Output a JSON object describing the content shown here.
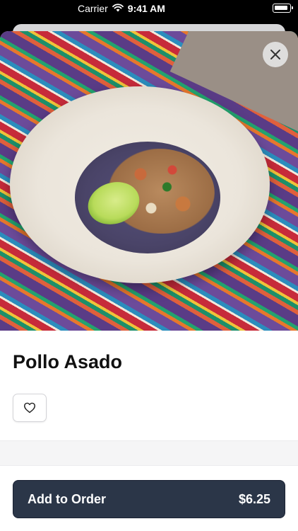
{
  "status_bar": {
    "carrier": "Carrier",
    "time": "9:41 AM"
  },
  "product": {
    "name": "Pollo Asado",
    "image_alt": "taco-photo"
  },
  "actions": {
    "add_to_order_label": "Add to Order",
    "price": "$6.25"
  },
  "colors": {
    "primary_button": "#2b3648"
  }
}
